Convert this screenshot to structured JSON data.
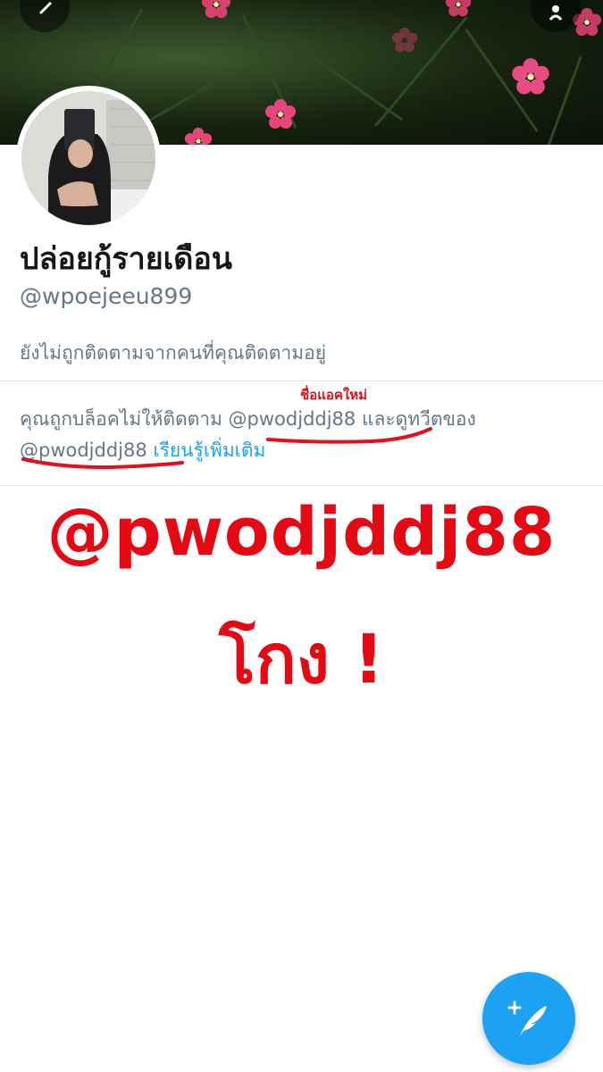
{
  "profile": {
    "display_name": "ปล่อยกู้รายเดือน",
    "handle": "@wpoejeeu899",
    "follow_status": "ยังไม่ถูกติดตามจากคนที่คุณติดตามอยู่"
  },
  "blocked": {
    "prefix": "คุณถูกบล็อคไม่ให้ติดตาม ",
    "mention1": "@pwodjddj88",
    "middle": " และดูทวีตของ ",
    "mention2": "@pwodjddj88",
    "link": "เรียนรู้เพิ่มเติม"
  },
  "annotations": {
    "new_account_label": "ชื่อแอคใหม่",
    "big_handle": "@pwodjddj88",
    "scam_text": "โกง !"
  },
  "icons": {
    "back": "back-arrow-icon",
    "add_user": "add-user-icon",
    "compose": "compose-tweet-icon"
  },
  "colors": {
    "brand": "#1da1f2",
    "annotation_red": "#e50914",
    "secondary_text": "#657786"
  }
}
